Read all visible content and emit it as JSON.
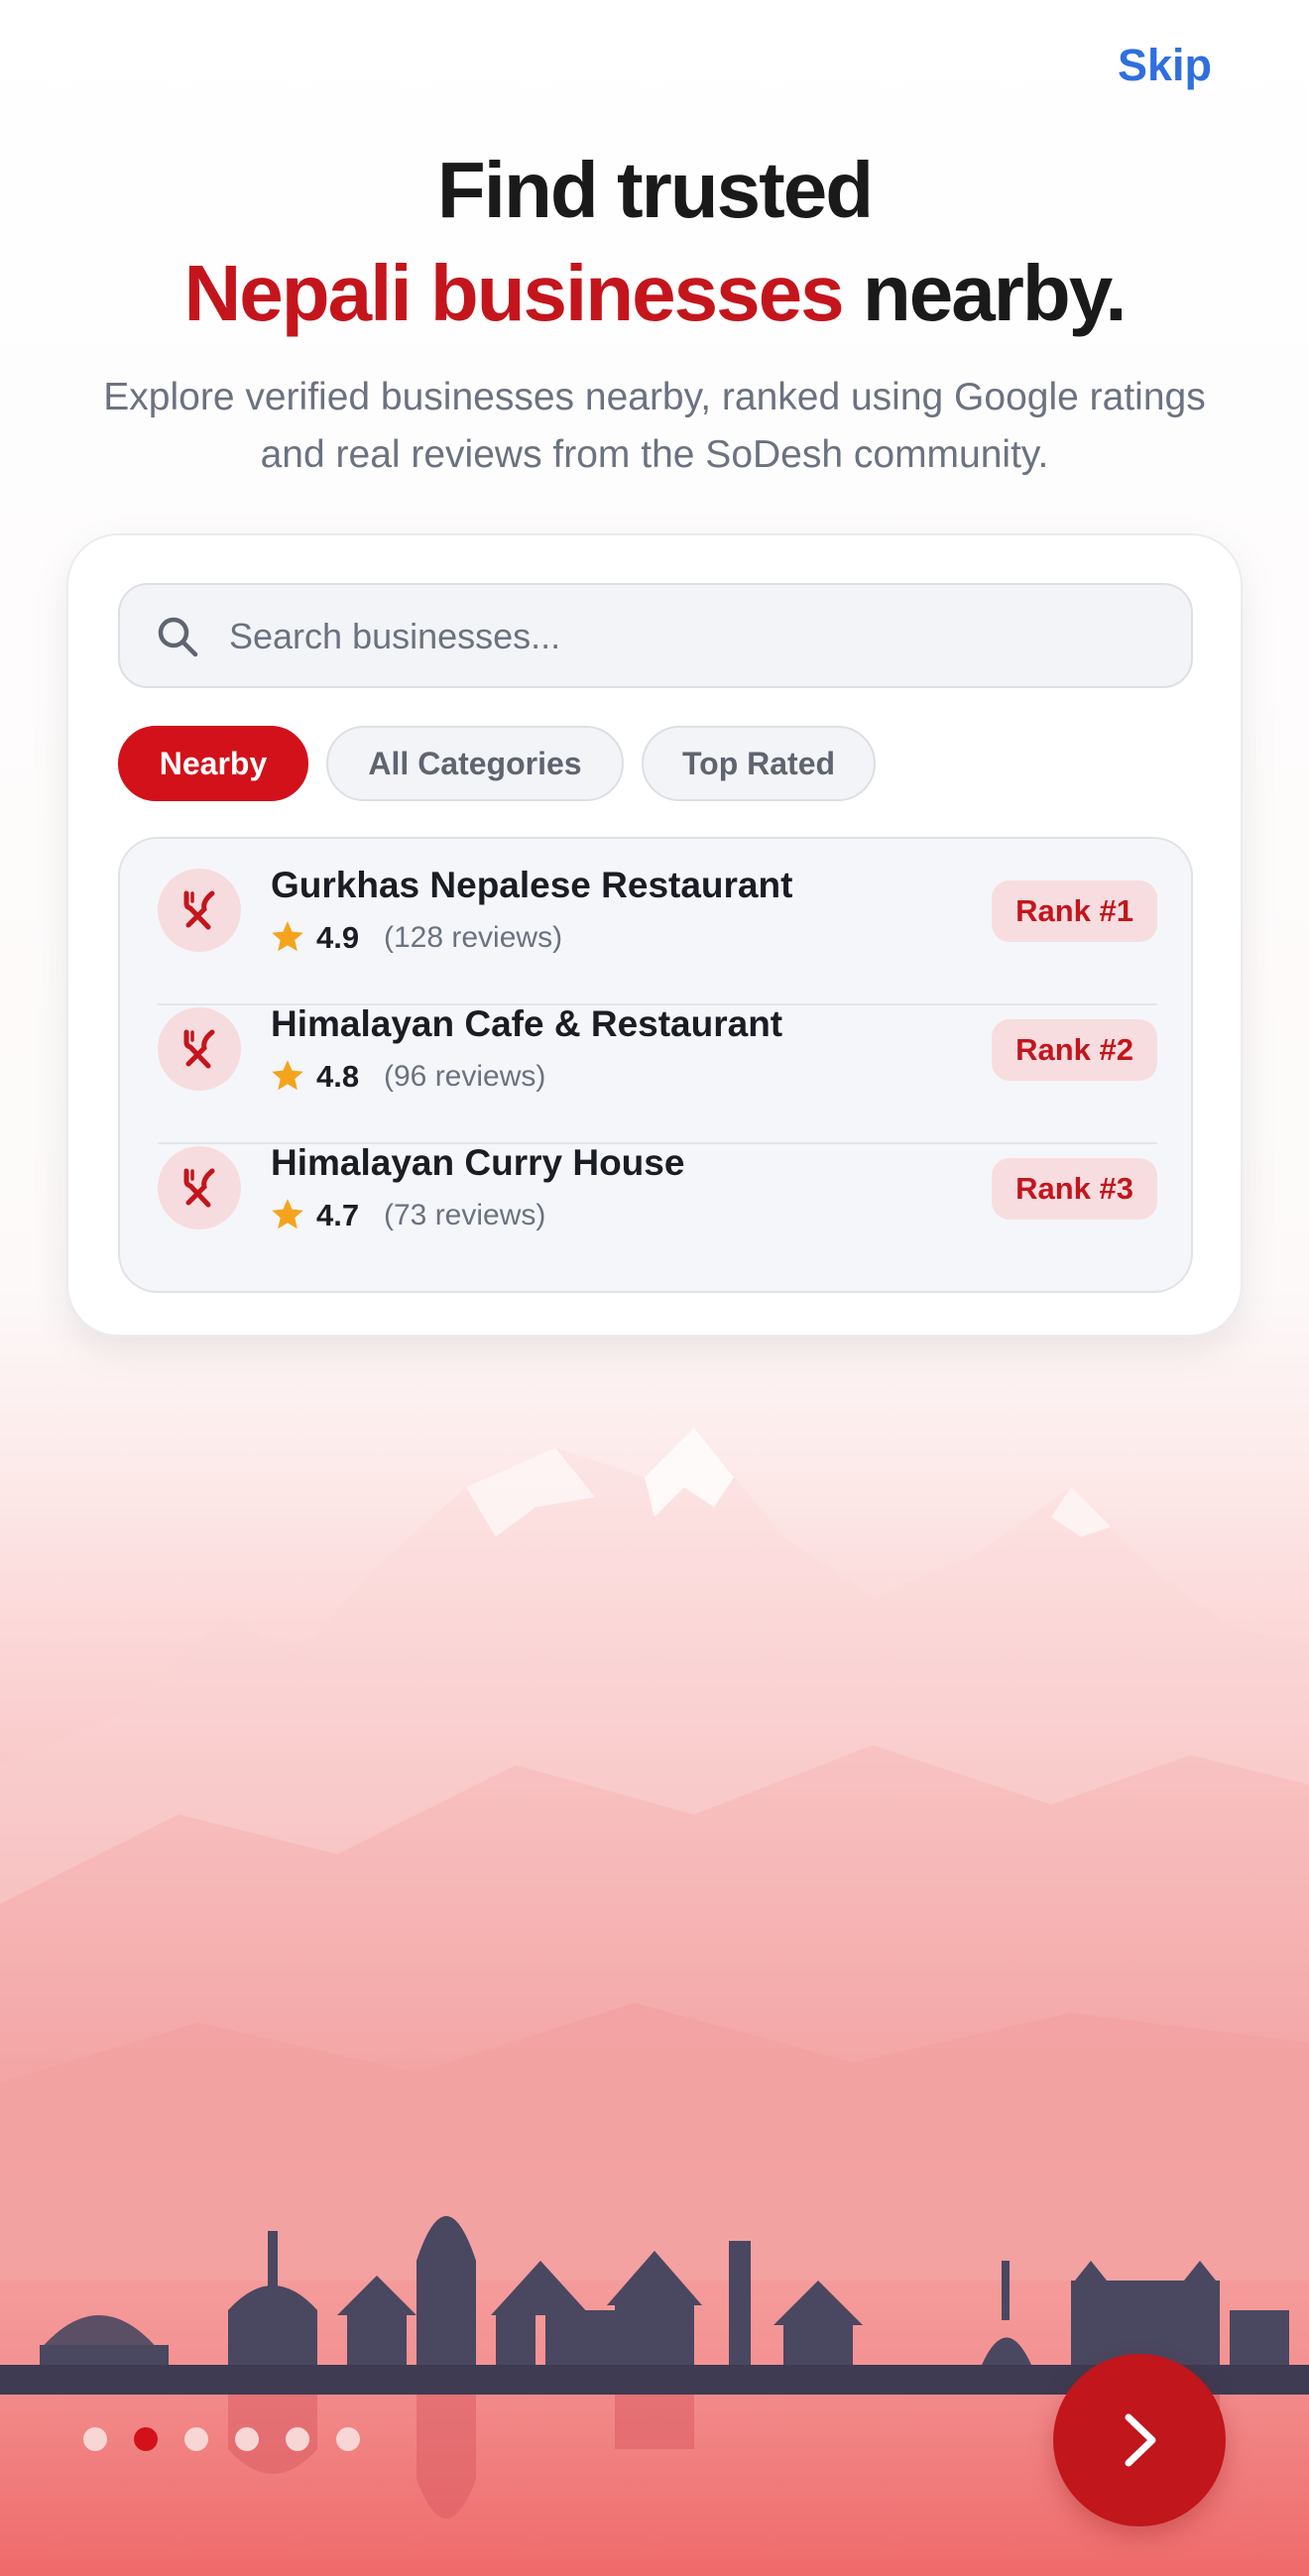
{
  "header": {
    "skip_label": "Skip"
  },
  "hero": {
    "title_line1": "Find trusted",
    "title_accent": "Nepali businesses",
    "title_rest": " nearby.",
    "subtitle": "Explore verified businesses nearby, ranked using Google ratings and real reviews from the SoDesh community."
  },
  "search": {
    "placeholder": "Search businesses...",
    "icon": "search-icon"
  },
  "filters": [
    {
      "label": "Nearby",
      "active": true
    },
    {
      "label": "All Categories",
      "active": false
    },
    {
      "label": "Top Rated",
      "active": false
    }
  ],
  "businesses": [
    {
      "name": "Gurkhas Nepalese Restaurant",
      "rating": "4.9",
      "reviews": "(128 reviews)",
      "rank": "Rank #1",
      "icon": "restaurant-icon"
    },
    {
      "name": "Himalayan Cafe & Restaurant",
      "rating": "4.8",
      "reviews": "(96 reviews)",
      "rank": "Rank #2",
      "icon": "restaurant-icon"
    },
    {
      "name": "Himalayan Curry House",
      "rating": "4.7",
      "reviews": "(73 reviews)",
      "rank": "Rank #3",
      "icon": "restaurant-icon"
    }
  ],
  "pagination": {
    "total": 6,
    "current": 2
  },
  "next_button": {
    "icon": "chevron-right-icon"
  },
  "colors": {
    "brand_red": "#d3111a",
    "accent_text": "#c4151c",
    "link_blue": "#2f6fde",
    "star": "#f4a41c"
  }
}
